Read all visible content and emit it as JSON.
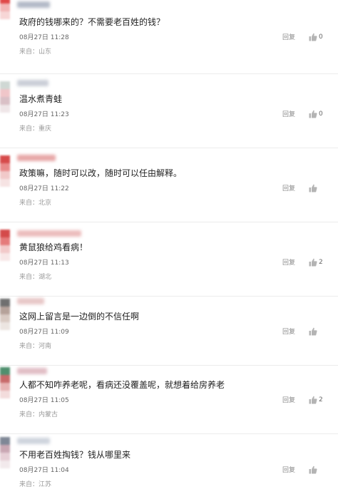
{
  "comments": [
    {
      "content": "政府的钱哪来的？不需要老百姓的钱？",
      "time": "08月27日 11:28",
      "reply_label": "回复",
      "likes": "0",
      "location": "来自：山东",
      "avatar_colors": [
        "#e04848",
        "#f2b6b6",
        "#f7d6d6",
        "#ffffff"
      ],
      "username_color": "#9aa3b5"
    },
    {
      "content": "温水煮青蛙",
      "time": "08月27日 11:23",
      "reply_label": "回复",
      "likes": "0",
      "location": "来自：重庆",
      "avatar_colors": [
        "#cfd8d4",
        "#f0c6c9",
        "#d9c0c6",
        "#efe6e8"
      ],
      "username_color": "#b9bfca"
    },
    {
      "content": "政策嘛，随时可以改，随时可以任由解释。",
      "time": "08月27日 11:22",
      "reply_label": "回复",
      "likes": "",
      "location": "来自：北京",
      "avatar_colors": [
        "#d64a4a",
        "#e88a8a",
        "#f1c9c9",
        "#f6e3e3"
      ],
      "username_color": "#e08b8b"
    },
    {
      "content": "黄鼠狼给鸡看病！",
      "time": "08月27日 11:13",
      "reply_label": "回复",
      "likes": "2",
      "location": "来自：湖北",
      "avatar_colors": [
        "#d44a4a",
        "#e57b7b",
        "#f2c9c9",
        "#f8e7e7"
      ],
      "username_color": "#e6a6a6"
    },
    {
      "content": "这网上留言是一边倒的不信任啊",
      "time": "08月27日 11:09",
      "reply_label": "回复",
      "likes": "",
      "location": "来自：河南",
      "avatar_colors": [
        "#6f6f6f",
        "#b5a29a",
        "#d9cbc4",
        "#ece5e1"
      ],
      "username_color": "#e0b5b5"
    },
    {
      "content": "人都不知咋养老呢，看病还没覆盖呢，就想着给房养老",
      "time": "08月27日 11:05",
      "reply_label": "回复",
      "likes": "2",
      "location": "来自：内蒙古",
      "avatar_colors": [
        "#4f8f6e",
        "#c86a6a",
        "#e7b4b4",
        "#f3dcdc"
      ],
      "username_color": "#d8a8b2"
    },
    {
      "content": "不用老百姓掏钱？钱从哪里来",
      "time": "08月27日 11:04",
      "reply_label": "回复",
      "likes": "",
      "location": "来自：江苏",
      "avatar_colors": [
        "#7f8796",
        "#c9a7b3",
        "#e6cfd6",
        "#f2e9ec"
      ],
      "username_color": "#bfc6d2"
    }
  ],
  "icons": {
    "like": "thumbs-up-icon"
  },
  "colors": {
    "like_icon": "#b4b4b4",
    "divider": "#ececec"
  }
}
